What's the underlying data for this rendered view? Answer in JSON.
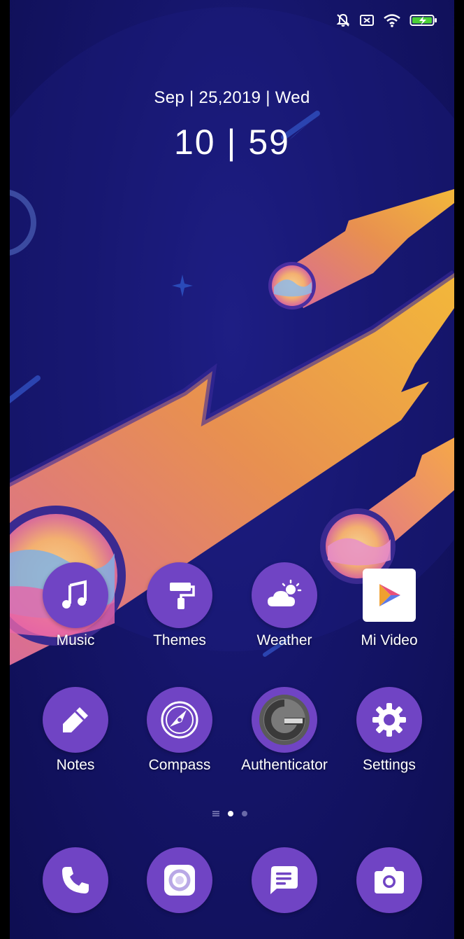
{
  "status_bar": {
    "icons": [
      "silent-bell-icon",
      "no-sim-icon",
      "wifi-icon",
      "battery-charging-icon"
    ],
    "battery_color": "#4cd137"
  },
  "clock": {
    "date": "Sep | 25,2019 | Wed",
    "time": "10 | 59"
  },
  "home_grid": [
    {
      "label": "Music",
      "icon": "music-note-icon"
    },
    {
      "label": "Themes",
      "icon": "paint-roller-icon"
    },
    {
      "label": "Weather",
      "icon": "weather-cloud-sun-icon"
    },
    {
      "label": "Mi Video",
      "icon": "play-triangle-icon"
    },
    {
      "label": "Notes",
      "icon": "pen-icon"
    },
    {
      "label": "Compass",
      "icon": "compass-icon"
    },
    {
      "label": "Authenticator",
      "icon": "authenticator-g-icon"
    },
    {
      "label": "Settings",
      "icon": "gear-icon"
    }
  ],
  "page_indicator": {
    "pages": 2,
    "current": 1
  },
  "dock": [
    {
      "icon": "phone-icon"
    },
    {
      "icon": "browser-icon"
    },
    {
      "icon": "messages-icon"
    },
    {
      "icon": "camera-icon"
    }
  ],
  "colors": {
    "icon_purple": "#7044c4",
    "background_navy": "#15156a",
    "comet_orange": "#f0a040",
    "comet_pink": "#e0688a"
  }
}
